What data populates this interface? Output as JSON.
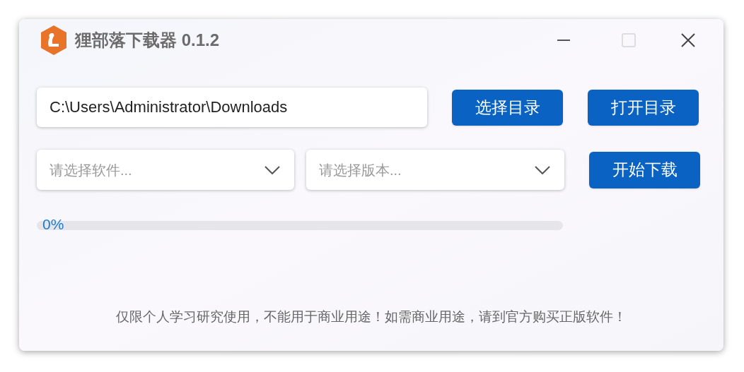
{
  "window": {
    "title": "狸部落下载器 0.1.2",
    "maximize_disabled": true
  },
  "path_field": {
    "value": "C:\\Users\\Administrator\\Downloads"
  },
  "buttons": [
    "选择目录",
    "打开目录"
  ],
  "dropdowns": [
    {
      "placeholder": "请选择软件..."
    },
    {
      "placeholder": "请选择版本..."
    }
  ],
  "download_button": "开始下载",
  "progress": {
    "level": 0,
    "reading": "0%"
  },
  "footer": "仅限个人学习研究使用，不能用于商业用途！如需商业用途，请到官方购买正版软件！"
}
